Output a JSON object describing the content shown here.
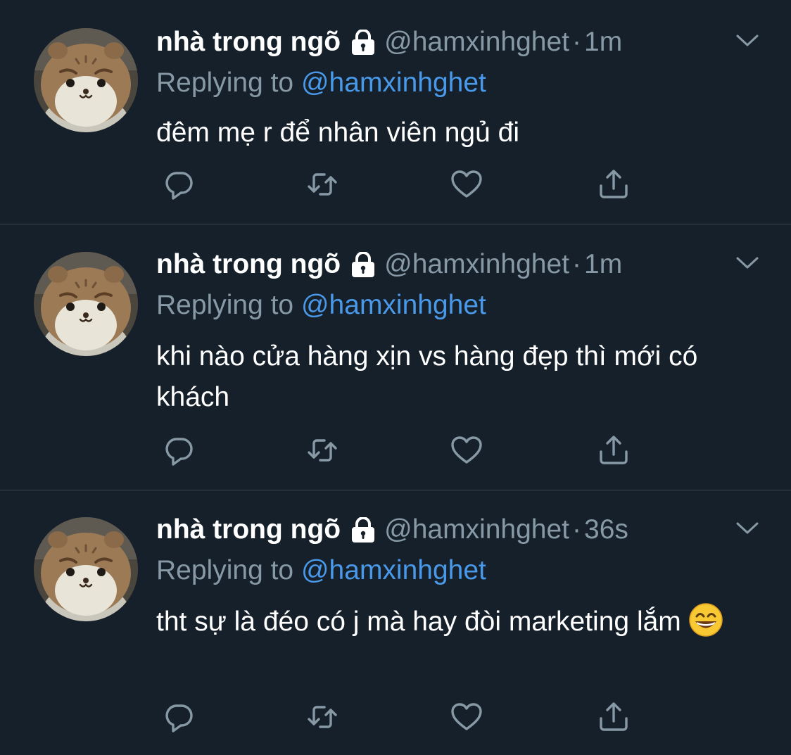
{
  "colors": {
    "background": "#15202b",
    "divider": "#38444d",
    "muted": "#8899a6",
    "link": "#4a99e9",
    "text": "#ffffff"
  },
  "tweets": [
    {
      "display_name": "nhà trong ngõ",
      "handle": "@hamxinhghet",
      "separator": "·",
      "time": "1m",
      "replying_prefix": "Replying to",
      "replying_to": "@hamxinhghet",
      "text": "đêm mẹ r để nhân viên ngủ đi",
      "emoji": ""
    },
    {
      "display_name": "nhà trong ngõ",
      "handle": "@hamxinhghet",
      "separator": "·",
      "time": "1m",
      "replying_prefix": "Replying to",
      "replying_to": "@hamxinhghet",
      "text": "khi nào cửa hàng xịn vs hàng đẹp thì mới có khách",
      "emoji": ""
    },
    {
      "display_name": "nhà trong ngõ",
      "handle": "@hamxinhghet",
      "separator": "·",
      "time": "36s",
      "replying_prefix": "Replying to",
      "replying_to": "@hamxinhghet",
      "text": "tht sự là đéo có j mà hay đòi marketing lắm",
      "emoji": "grinning-face-with-smiling-eyes"
    }
  ],
  "icons": {
    "lock": "lock-icon",
    "more": "chevron-down-icon",
    "reply": "reply-icon",
    "retweet": "retweet-icon",
    "like": "heart-icon",
    "share": "share-icon"
  }
}
